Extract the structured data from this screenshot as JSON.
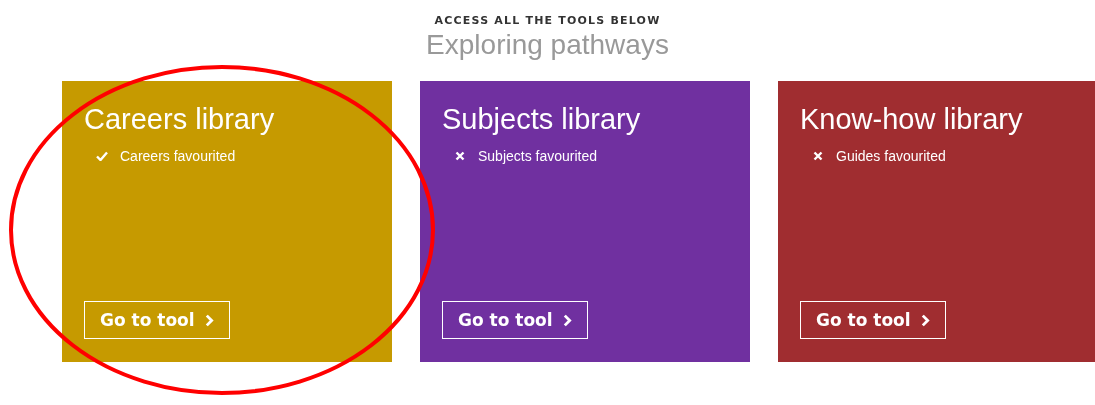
{
  "header": {
    "eyebrow": "ACCESS ALL THE TOOLS BELOW",
    "title": "Exploring pathways"
  },
  "cards": [
    {
      "title": "Careers library",
      "color": "#c69a00",
      "status": {
        "label": "Careers favourited",
        "checked": true
      },
      "button": "Go to tool"
    },
    {
      "title": "Subjects library",
      "color": "#7030a0",
      "status": {
        "label": "Subjects favourited",
        "checked": false
      },
      "button": "Go to tool"
    },
    {
      "title": "Know-how library",
      "color": "#a02d30",
      "status": {
        "label": "Guides favourited",
        "checked": false
      },
      "button": "Go to tool"
    }
  ],
  "annotation": {
    "kind": "ellipse",
    "color": "#ff0000"
  }
}
